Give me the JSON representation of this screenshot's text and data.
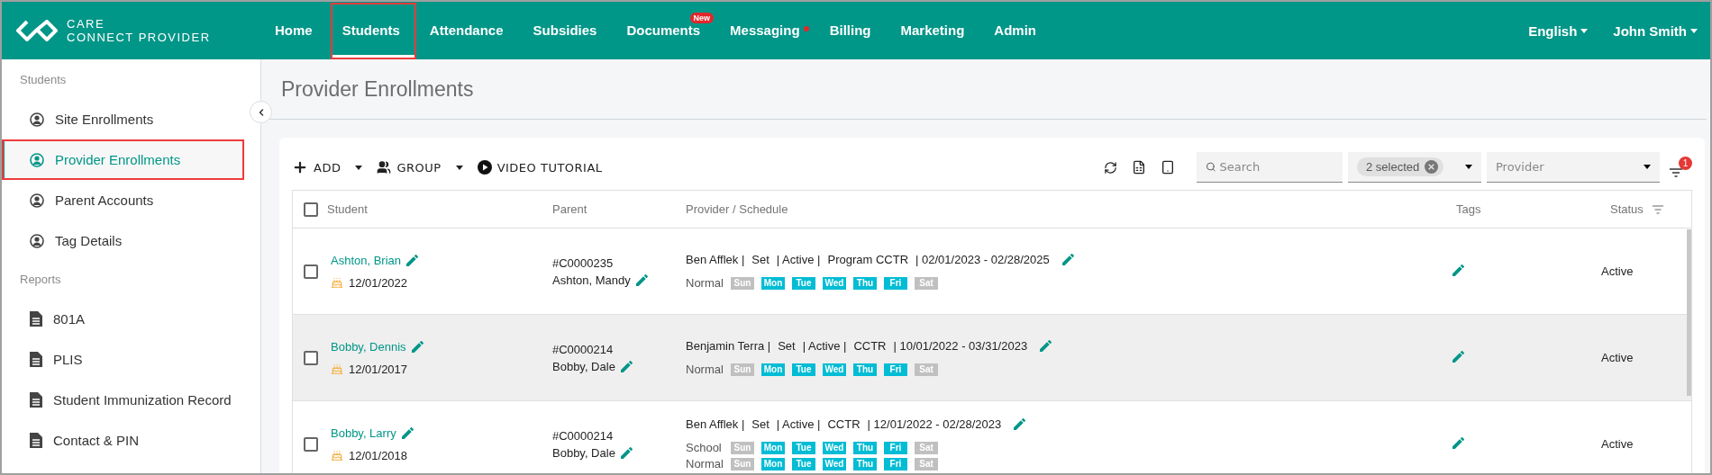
{
  "header": {
    "logo": {
      "line1": "CARE",
      "line2": "CONNECT PROVIDER"
    },
    "nav": [
      {
        "label": "Home",
        "selected": false,
        "highlighted": false
      },
      {
        "label": "Students",
        "selected": true,
        "highlighted": true
      },
      {
        "label": "Attendance",
        "selected": false,
        "highlighted": false
      },
      {
        "label": "Subsidies",
        "selected": false,
        "highlighted": false
      },
      {
        "label": "Documents",
        "selected": false,
        "highlighted": false,
        "badge": "New"
      },
      {
        "label": "Messaging",
        "selected": false,
        "highlighted": false,
        "dot": true
      },
      {
        "label": "Billing",
        "selected": false,
        "highlighted": false
      },
      {
        "label": "Marketing",
        "selected": false,
        "highlighted": false
      },
      {
        "label": "Admin",
        "selected": false,
        "highlighted": false
      }
    ],
    "menus": [
      "English",
      "John Smith"
    ]
  },
  "sidebar": {
    "sections": [
      {
        "title": "Students",
        "items": [
          {
            "label": "Site Enrollments",
            "kind": "person",
            "selected": false,
            "highlighted": false
          },
          {
            "label": "Provider Enrollments",
            "kind": "person",
            "selected": true,
            "highlighted": true
          },
          {
            "label": "Parent Accounts",
            "kind": "person",
            "selected": false,
            "highlighted": false
          },
          {
            "label": "Tag Details",
            "kind": "person",
            "selected": false,
            "highlighted": false
          }
        ]
      },
      {
        "title": "Reports",
        "items": [
          {
            "label": "801A",
            "kind": "report",
            "selected": false,
            "highlighted": false
          },
          {
            "label": "PLIS",
            "kind": "report",
            "selected": false,
            "highlighted": false
          },
          {
            "label": "Student Immunization Record",
            "kind": "report",
            "selected": false,
            "highlighted": false
          },
          {
            "label": "Contact & PIN",
            "kind": "report",
            "selected": false,
            "highlighted": false
          }
        ]
      }
    ]
  },
  "page_title": "Provider Enrollments",
  "toolbar": {
    "actions": [
      {
        "label": "ADD",
        "kind": "add"
      },
      {
        "label": "GROUP",
        "kind": "group"
      },
      {
        "label": "VIDEO TUTORIAL",
        "kind": "video"
      }
    ],
    "search": {
      "placeholder": "Search"
    },
    "chip": "2 selected",
    "provider": {
      "placeholder": "Provider"
    },
    "filter_badge": "1"
  },
  "table": {
    "all_checked": false,
    "columns": [
      "Student",
      "Parent",
      "Provider / Schedule",
      "Tags",
      "Status"
    ],
    "rows": [
      {
        "student": "Ashton, Brian",
        "birthday": "12/01/2022",
        "parent_id": "#C0000235",
        "parent": "Ashton, Mandy",
        "checked": false,
        "striped": false,
        "provider": [
          "Ben Afflek |",
          "Set",
          "| Active |",
          "Program CCTR",
          "| 02/01/2023 - 02/28/2025"
        ],
        "schedules": [
          {
            "label": "Normal",
            "days": [
              {
                "day": "Sun",
                "on": false
              },
              {
                "day": "Mon",
                "on": true
              },
              {
                "day": "Tue",
                "on": true
              },
              {
                "day": "Wed",
                "on": true
              },
              {
                "day": "Thu",
                "on": true
              },
              {
                "day": "Fri",
                "on": true
              },
              {
                "day": "Sat",
                "on": false
              }
            ]
          }
        ],
        "status": "Active"
      },
      {
        "student": "Bobby, Dennis",
        "birthday": "12/01/2017",
        "parent_id": "#C0000214",
        "parent": "Bobby, Dale",
        "checked": false,
        "striped": true,
        "provider": [
          "Benjamin Terra |",
          "Set",
          "| Active |",
          "CCTR",
          "| 10/01/2022 - 03/31/2023"
        ],
        "schedules": [
          {
            "label": "Normal",
            "days": [
              {
                "day": "Sun",
                "on": false
              },
              {
                "day": "Mon",
                "on": true
              },
              {
                "day": "Tue",
                "on": true
              },
              {
                "day": "Wed",
                "on": true
              },
              {
                "day": "Thu",
                "on": true
              },
              {
                "day": "Fri",
                "on": true
              },
              {
                "day": "Sat",
                "on": false
              }
            ]
          }
        ],
        "status": "Active"
      },
      {
        "student": "Bobby, Larry",
        "birthday": "12/01/2018",
        "parent_id": "#C0000214",
        "parent": "Bobby, Dale",
        "checked": false,
        "striped": false,
        "provider": [
          "Ben Afflek |",
          "Set",
          "| Active |",
          "CCTR",
          "| 12/01/2022 - 02/28/2023"
        ],
        "schedules": [
          {
            "label": "School",
            "days": [
              {
                "day": "Sun",
                "on": false
              },
              {
                "day": "Mon",
                "on": true
              },
              {
                "day": "Tue",
                "on": true
              },
              {
                "day": "Wed",
                "on": true
              },
              {
                "day": "Thu",
                "on": true
              },
              {
                "day": "Fri",
                "on": true
              },
              {
                "day": "Sat",
                "on": false
              }
            ]
          },
          {
            "label": "Normal",
            "days": [
              {
                "day": "Sun",
                "on": false
              },
              {
                "day": "Mon",
                "on": true
              },
              {
                "day": "Tue",
                "on": true
              },
              {
                "day": "Wed",
                "on": true
              },
              {
                "day": "Thu",
                "on": true
              },
              {
                "day": "Fri",
                "on": true
              },
              {
                "day": "Sat",
                "on": false
              }
            ]
          }
        ],
        "status": "Active"
      }
    ]
  }
}
